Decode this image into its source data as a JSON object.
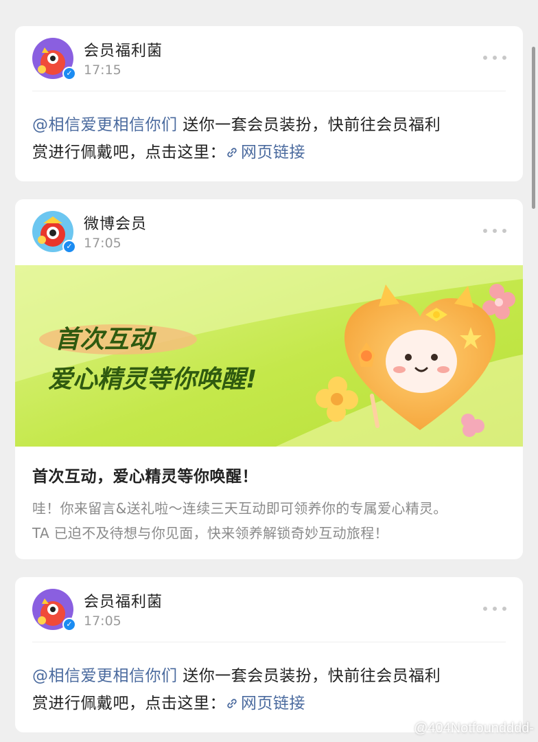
{
  "cards": [
    {
      "sender": "会员福利菌",
      "time": "17:15",
      "mention": "@相信爱更相信你们",
      "line1_rest": " 送你一套会员装扮，快前往会员福利",
      "line2_text": "赏进行佩戴吧，点击这里：",
      "link_text": "网页链接"
    },
    {
      "sender": "微博会员",
      "time": "17:05",
      "banner_line1": "首次互动",
      "banner_line2": "爱心精灵等你唤醒!",
      "title": "首次互动，爱心精灵等你唤醒！",
      "desc_line1": "哇！你来留言&送礼啦～连续三天互动即可领养你的专属爱心精灵。",
      "desc_line2": "TA 已迫不及待想与你见面，快来领养解锁奇妙互动旅程！"
    },
    {
      "sender": "会员福利菌",
      "time": "17:05",
      "mention": "@相信爱更相信你们",
      "line1_rest": " 送你一套会员装扮，快前往会员福利",
      "line2_text": "赏进行佩戴吧，点击这里：",
      "link_text": "网页链接"
    }
  ],
  "watermark": "@404Notfoundddd-",
  "colors": {
    "background": "#efefef",
    "card": "#ffffff",
    "link": "#4a6a9e",
    "verified_badge": "#1b8cf2",
    "time": "#9a9a9a",
    "banner_green": "#c9ec4a",
    "banner_text": "#2f5a10"
  },
  "icons": {
    "more": "more-dots-icon",
    "verified": "verified-badge-icon",
    "link": "link-chain-icon"
  }
}
